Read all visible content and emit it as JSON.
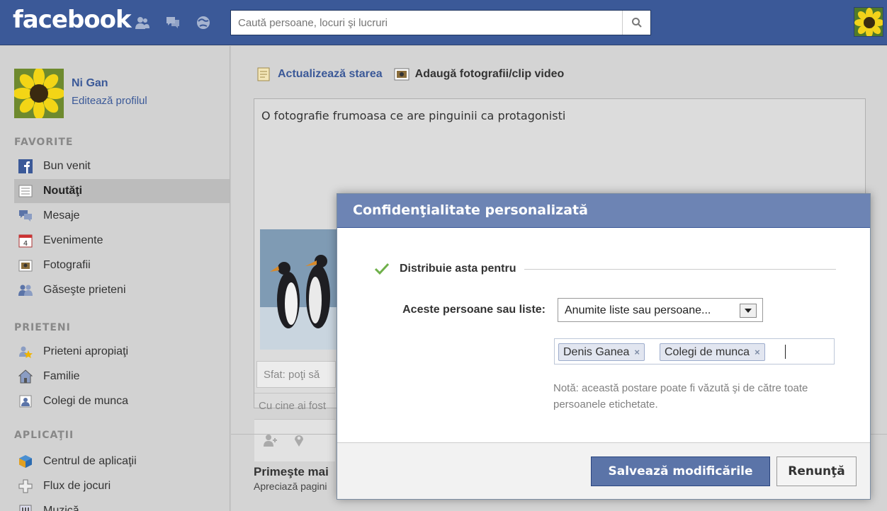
{
  "app": {
    "logo": "facebook"
  },
  "topbar": {
    "search_placeholder": "Caută persoane, locuri şi lucruri",
    "jewels": [
      "friend-requests-icon",
      "messages-icon",
      "notifications-icon"
    ]
  },
  "profile": {
    "name": "Ni Gan",
    "edit_label": "Editează profilul"
  },
  "sidebar": {
    "favorites_title": "FAVORITE",
    "favorites": [
      {
        "label": "Bun venit",
        "icon": "facebook-f-icon"
      },
      {
        "label": "Noutăţi",
        "icon": "news-feed-icon",
        "selected": true
      },
      {
        "label": "Mesaje",
        "icon": "messages-icon"
      },
      {
        "label": "Evenimente",
        "icon": "calendar-icon"
      },
      {
        "label": "Fotografii",
        "icon": "photos-icon"
      },
      {
        "label": "Găseşte prieteni",
        "icon": "find-friends-icon"
      }
    ],
    "friends_title": "PRIETENI",
    "friends": [
      {
        "label": "Prieteni apropiaţi",
        "icon": "star-friends-icon"
      },
      {
        "label": "Familie",
        "icon": "house-icon"
      },
      {
        "label": "Colegi de munca",
        "icon": "work-icon"
      }
    ],
    "apps_title": "APLICAŢII",
    "apps": [
      {
        "label": "Centrul de aplicaţii",
        "icon": "app-center-icon"
      },
      {
        "label": "Flux de jocuri",
        "icon": "games-icon"
      },
      {
        "label": "Muzică",
        "icon": "music-icon"
      }
    ]
  },
  "composer": {
    "tab_status": "Actualizează starea",
    "tab_photo": "Adaugă fotografii/clip video",
    "text": "O fotografie frumoasa ce are pinguinii ca protagonisti",
    "tip_placeholder": "Sfat: poţi să",
    "with_placeholder": "Cu cine ai fost"
  },
  "promo": {
    "title": "Primeşte mai",
    "subtitle": "Apreciază pagini"
  },
  "dialog": {
    "title": "Confidenţialitate personalizată",
    "share_label": "Distribuie asta pentru",
    "people_label": "Aceste persoane sau liste:",
    "select_value": "Anumite liste sau persoane...",
    "tokens": [
      "Denis Ganea",
      "Colegi de munca"
    ],
    "token_remove": "×",
    "note": "Notă: această postare poate fi văzută şi de către toate persoanele etichetate.",
    "save_label": "Salvează modificările",
    "cancel_label": "Renunţă"
  },
  "colors": {
    "brand": "#3b5998",
    "dialog_header": "#6d84b4",
    "save_button": "#5b74a8"
  }
}
